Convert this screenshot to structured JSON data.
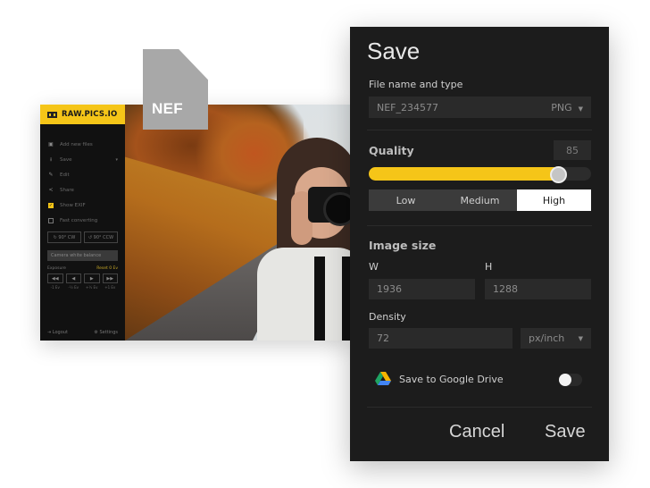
{
  "file_badge": {
    "label": "NEF"
  },
  "app": {
    "brand": "RAW.PICS.IO",
    "menu": [
      {
        "icon": "add-files-icon",
        "glyph": "▣",
        "label": "Add new files"
      },
      {
        "icon": "download-icon",
        "glyph": "⭳",
        "label": "Save",
        "caret": "▾"
      },
      {
        "icon": "pencil-icon",
        "glyph": "✎",
        "label": "Edit"
      },
      {
        "icon": "share-icon",
        "glyph": "<",
        "label": "Share"
      },
      {
        "icon": "checkbox-checked-icon",
        "glyph": "✓",
        "label": "Show EXIF"
      },
      {
        "icon": "checkbox-empty-icon",
        "glyph": "",
        "label": "Fast converting"
      }
    ],
    "rotate_cw": "↻ 90° CW",
    "rotate_ccw": "↺ 90° CCW",
    "white_balance": "Camera white balance",
    "exposure_label": "Exposure",
    "exposure_reset": "Reset 0 Ev",
    "exposure_buttons": [
      "◀◀",
      "◀",
      "▶",
      "▶▶"
    ],
    "exposure_steps": [
      "-1 Ev",
      "-½ Ev",
      "+½ Ev",
      "+1 Ev"
    ],
    "logout": "Logout",
    "settings": "Settings"
  },
  "dialog": {
    "title": "Save",
    "file_section_label": "File name and type",
    "file_name": "NEF_234577",
    "file_type": "PNG",
    "quality_label": "Quality",
    "quality_value": "85",
    "quality_percent": 85,
    "quality_presets": [
      "Low",
      "Medium",
      "High"
    ],
    "quality_selected": "High",
    "image_size_label": "Image size",
    "width_label": "W",
    "width_value": "1936",
    "height_label": "H",
    "height_value": "1288",
    "density_label": "Density",
    "density_value": "72",
    "density_unit": "px/inch",
    "gdrive_label": "Save to Google Drive",
    "gdrive_enabled": false,
    "cancel_label": "Cancel",
    "save_label": "Save"
  },
  "colors": {
    "accent": "#f5c518",
    "dialog_bg": "#1c1c1c",
    "field_bg": "#2a2a2a"
  }
}
